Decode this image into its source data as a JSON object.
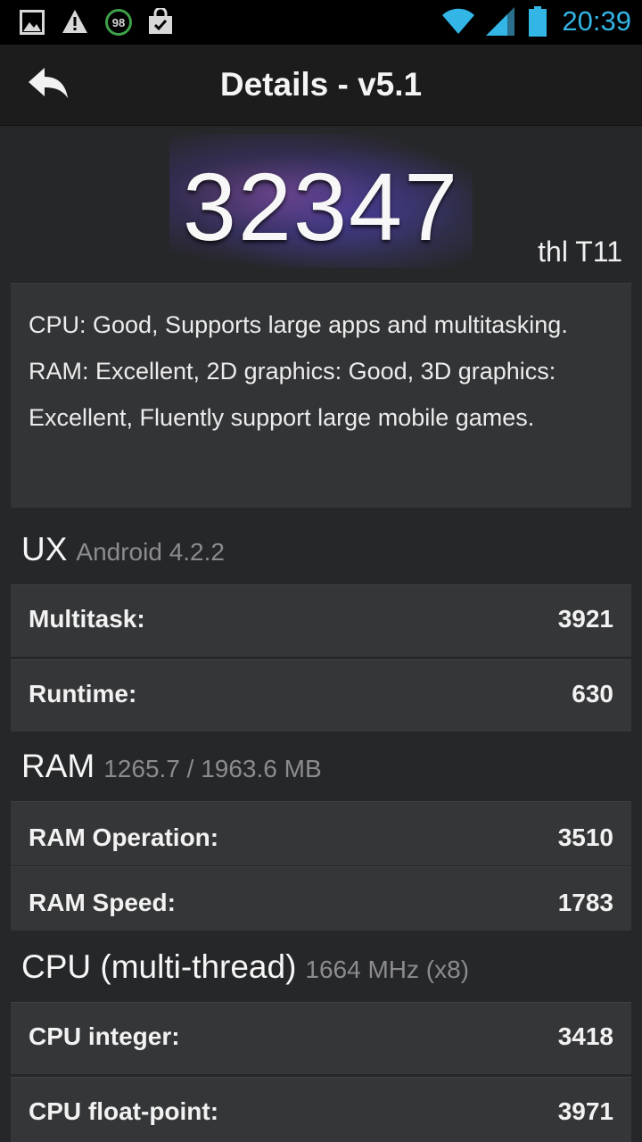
{
  "status_bar": {
    "icons": [
      "gallery-icon",
      "warning-icon",
      "battery-98-badge-icon",
      "shopping-bag-icon"
    ],
    "badge_text": "98",
    "right_icons": [
      "wifi-icon",
      "signal-icon",
      "battery-icon"
    ],
    "time": "20:39",
    "accent_color": "#33b5e5"
  },
  "header": {
    "title": "Details - v5.1",
    "back_icon": "back-arrow-icon"
  },
  "score": {
    "value": "32347",
    "device": "thl T11"
  },
  "summary": "CPU: Good, Supports large apps and multitasking. RAM: Excellent, 2D graphics: Good, 3D graphics: Excellent, Fluently support large mobile games.",
  "sections": {
    "ux": {
      "title": "UX",
      "subtitle": "Android 4.2.2",
      "rows": [
        {
          "label": "Multitask:",
          "value": "3921"
        },
        {
          "label": "Runtime:",
          "value": "630"
        }
      ]
    },
    "ram": {
      "title": "RAM",
      "subtitle": "1265.7 / 1963.6 MB",
      "rows": [
        {
          "label": "RAM Operation:",
          "value": "3510"
        },
        {
          "label": "RAM Speed:",
          "value": "1783"
        }
      ]
    },
    "cpu": {
      "title": "CPU (multi-thread)",
      "subtitle": "1664 MHz (x8)",
      "rows": [
        {
          "label": "CPU integer:",
          "value": "3418"
        },
        {
          "label": "CPU float-point:",
          "value": "3971"
        }
      ]
    }
  }
}
